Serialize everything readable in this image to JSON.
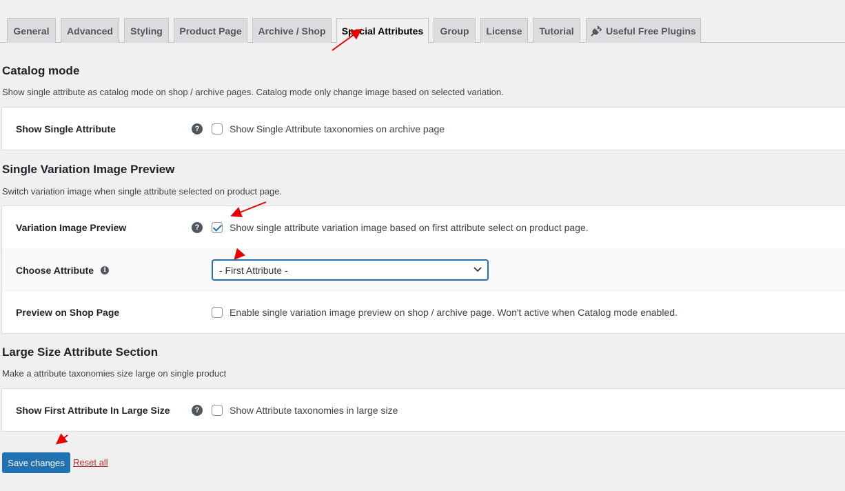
{
  "tabs": [
    {
      "label": "General",
      "active": false
    },
    {
      "label": "Advanced",
      "active": false
    },
    {
      "label": "Styling",
      "active": false
    },
    {
      "label": "Product Page",
      "active": false
    },
    {
      "label": "Archive / Shop",
      "active": false
    },
    {
      "label": "Special Attributes",
      "active": true
    },
    {
      "label": "Group",
      "active": false
    },
    {
      "label": "License",
      "active": false
    },
    {
      "label": "Tutorial",
      "active": false
    },
    {
      "label": "Useful Free Plugins",
      "active": false,
      "icon": "plug-icon"
    }
  ],
  "catalog": {
    "title": "Catalog mode",
    "description": "Show single attribute as catalog mode on shop / archive pages. Catalog mode only change image based on selected variation.",
    "rows": [
      {
        "label": "Show Single Attribute",
        "checkbox_label": "Show Single Attribute taxonomies on archive page",
        "checked": false
      }
    ]
  },
  "variation": {
    "title": "Single Variation Image Preview",
    "description": "Switch variation image when single attribute selected on product page.",
    "preview": {
      "label": "Variation Image Preview",
      "checkbox_label": "Show single attribute variation image based on first attribute select on product page.",
      "checked": true
    },
    "choose": {
      "label": "Choose Attribute",
      "selected": "- First Attribute -"
    },
    "shop": {
      "label": "Preview on Shop Page",
      "checkbox_label": "Enable single variation image preview on shop / archive page. Won't active when Catalog mode enabled.",
      "checked": false
    }
  },
  "large": {
    "title": "Large Size Attribute Section",
    "description": "Make a attribute taxonomies size large on single product",
    "rows": [
      {
        "label": "Show First Attribute In Large Size",
        "checkbox_label": "Show Attribute taxonomies in large size",
        "checked": false
      }
    ]
  },
  "footer": {
    "save_label": "Save changes",
    "reset_label": "Reset all"
  },
  "colors": {
    "accent": "#2271b1",
    "annotation_arrow": "#e60000",
    "reset_link": "#b32d2e"
  }
}
